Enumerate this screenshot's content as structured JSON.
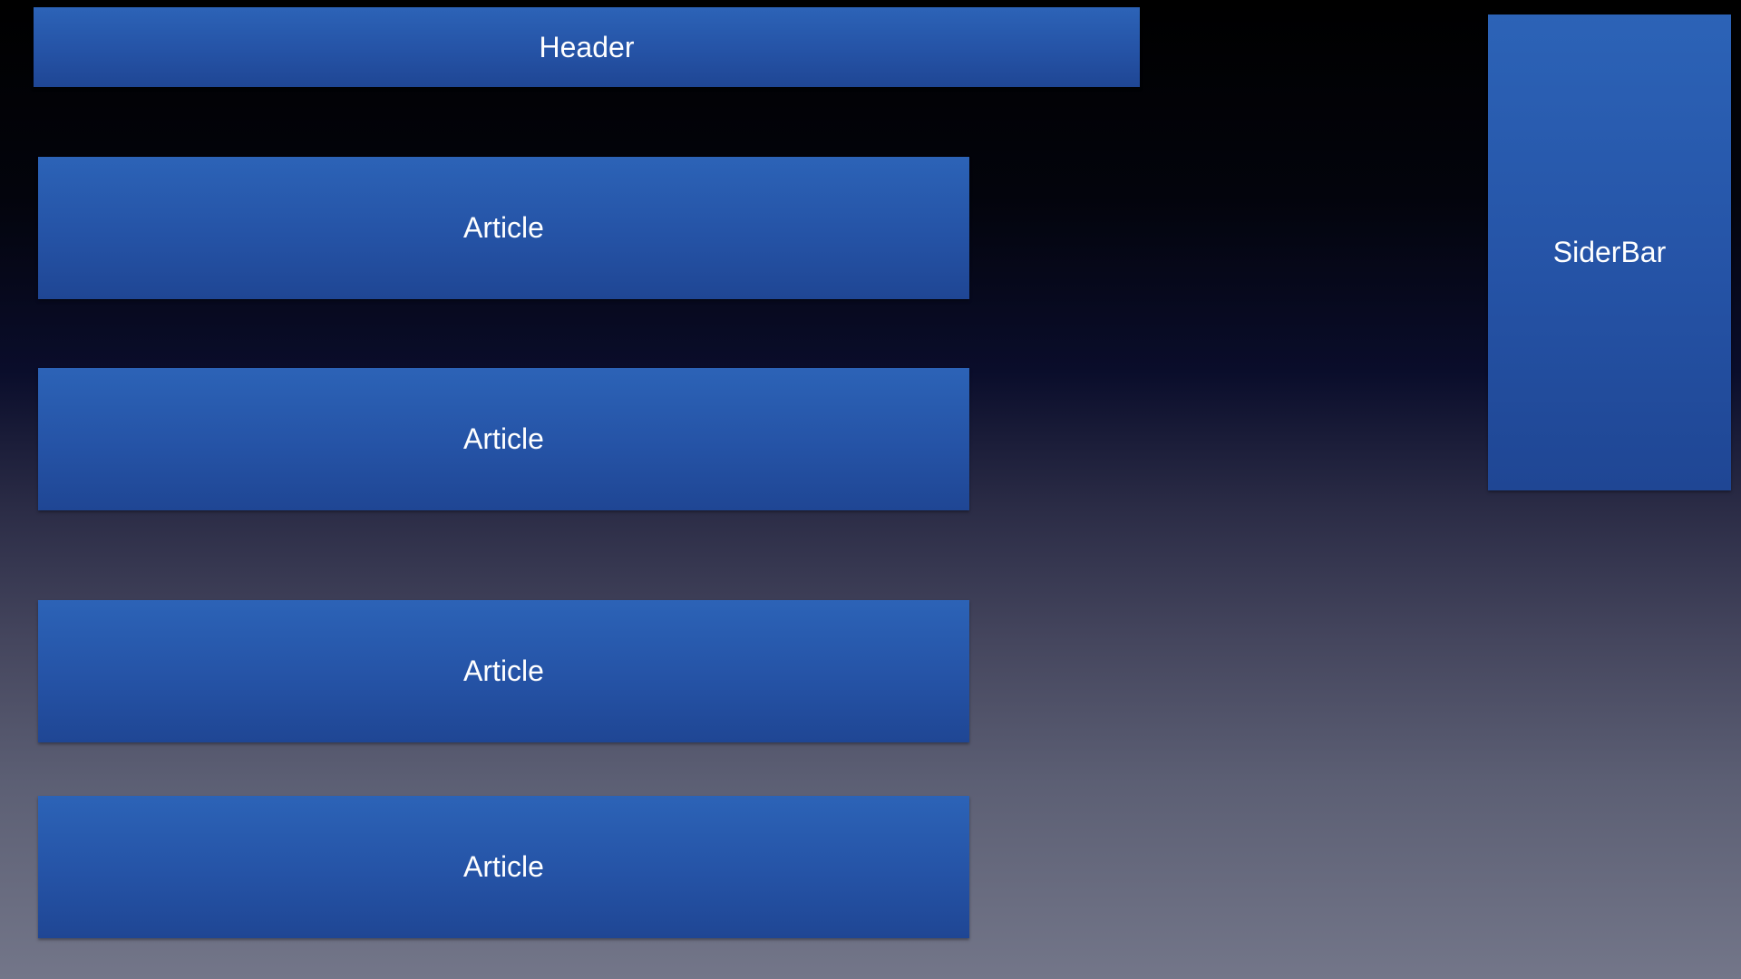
{
  "header": {
    "label": "Header"
  },
  "sidebar": {
    "label": "SiderBar"
  },
  "articles": [
    {
      "label": "Article"
    },
    {
      "label": "Article"
    },
    {
      "label": "Article"
    },
    {
      "label": "Article"
    }
  ],
  "colors": {
    "block_top": "#2c63b7",
    "block_bottom": "#1f4694",
    "background_top": "#000000",
    "background_bottom": "#737689",
    "text": "#ffffff"
  }
}
